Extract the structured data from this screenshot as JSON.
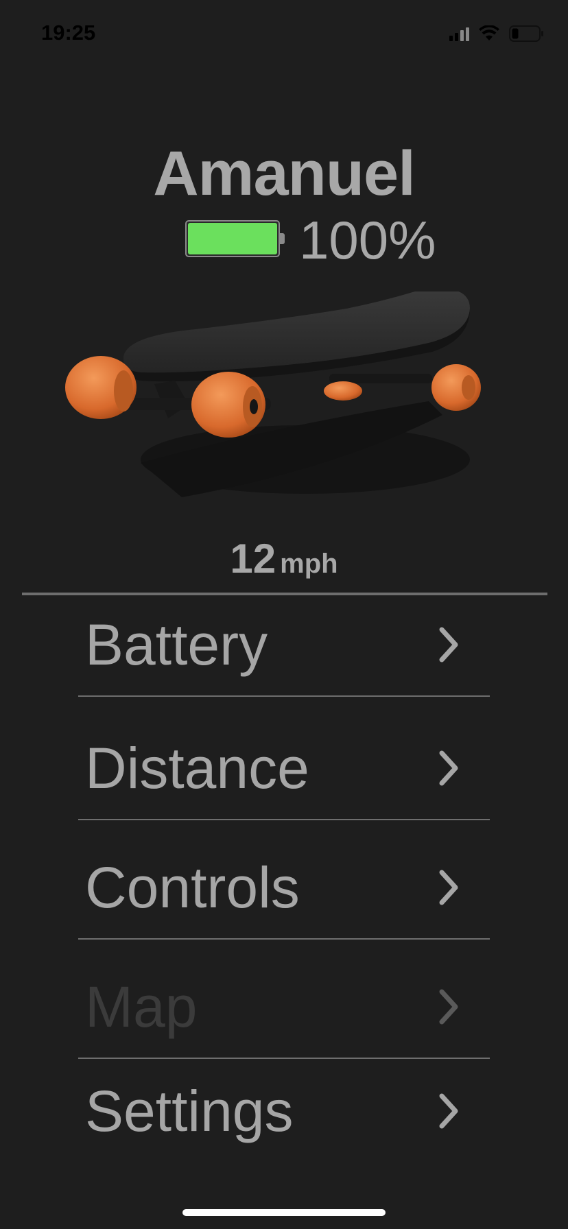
{
  "status_bar": {
    "time": "19:25",
    "signal_icon": "cellular-signal-icon",
    "wifi_icon": "wifi-icon",
    "battery_icon": "status-battery-icon"
  },
  "profile": {
    "name": "Amanuel",
    "battery_percent_text": "100%",
    "battery_level": 1.0,
    "battery_color": "#6be05d"
  },
  "board_image": {
    "icon": "skateboard-image",
    "deck_color": "#2b2b2b",
    "wheel_color": "#e0773a"
  },
  "speed": {
    "value": "12",
    "unit": "mph"
  },
  "menu": {
    "items": [
      {
        "label": "Battery",
        "enabled": true
      },
      {
        "label": "Distance",
        "enabled": true
      },
      {
        "label": "Controls",
        "enabled": true
      },
      {
        "label": "Map",
        "enabled": false
      },
      {
        "label": "Settings",
        "enabled": true
      }
    ],
    "chevron_icon": "chevron-right-icon"
  }
}
